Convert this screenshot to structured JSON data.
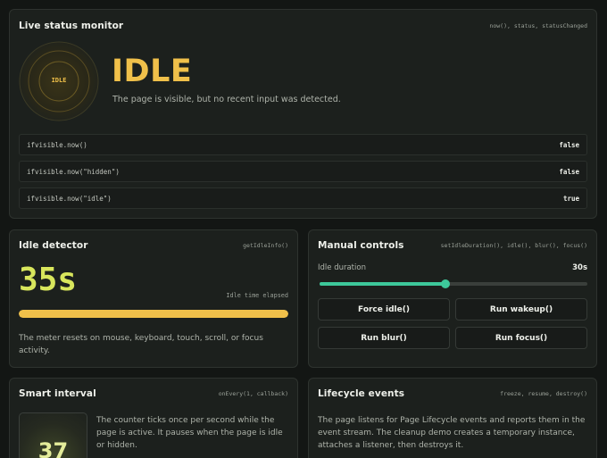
{
  "live": {
    "title": "Live status monitor",
    "meta": "now(), status, statusChanged",
    "ring_label": "IDLE",
    "state": "IDLE",
    "description": "The page is visible, but no recent input was detected.",
    "rows": [
      {
        "key": "ifvisible.now()",
        "value": "false"
      },
      {
        "key": "ifvisible.now(\"hidden\")",
        "value": "false"
      },
      {
        "key": "ifvisible.now(\"idle\")",
        "value": "true"
      }
    ]
  },
  "idle": {
    "title": "Idle detector",
    "meta": "getIdleInfo()",
    "seconds": "35s",
    "elapsed_label": "Idle time elapsed",
    "meter_fraction": 1.0,
    "note": "The meter resets on mouse, keyboard, touch, scroll, or focus activity."
  },
  "manual": {
    "title": "Manual controls",
    "meta": "setIdleDuration(), idle(), blur(), focus()",
    "duration_label": "Idle duration",
    "duration_value": "30s",
    "slider_fraction": 0.47,
    "buttons": {
      "force_idle": "Force idle()",
      "run_wakeup": "Run wakeup()",
      "run_blur": "Run blur()",
      "run_focus": "Run focus()"
    }
  },
  "smart": {
    "title": "Smart interval",
    "meta": "onEvery(1, callback)",
    "counter": "37",
    "note": "The counter ticks once per second while the page is active. It pauses when the page is idle or hidden."
  },
  "life": {
    "title": "Lifecycle events",
    "meta": "freeze, resume, destroy()",
    "note": "The page listens for Page Lifecycle events and reports them in the event stream. The cleanup demo creates a temporary instance, attaches a listener, then destroys it."
  },
  "colors": {
    "accent_idle": "#f0c04a",
    "accent_count": "#d8e65c",
    "accent_slider": "#3dc89a",
    "panel_bg": "#1c201d",
    "page_bg": "#131614"
  }
}
